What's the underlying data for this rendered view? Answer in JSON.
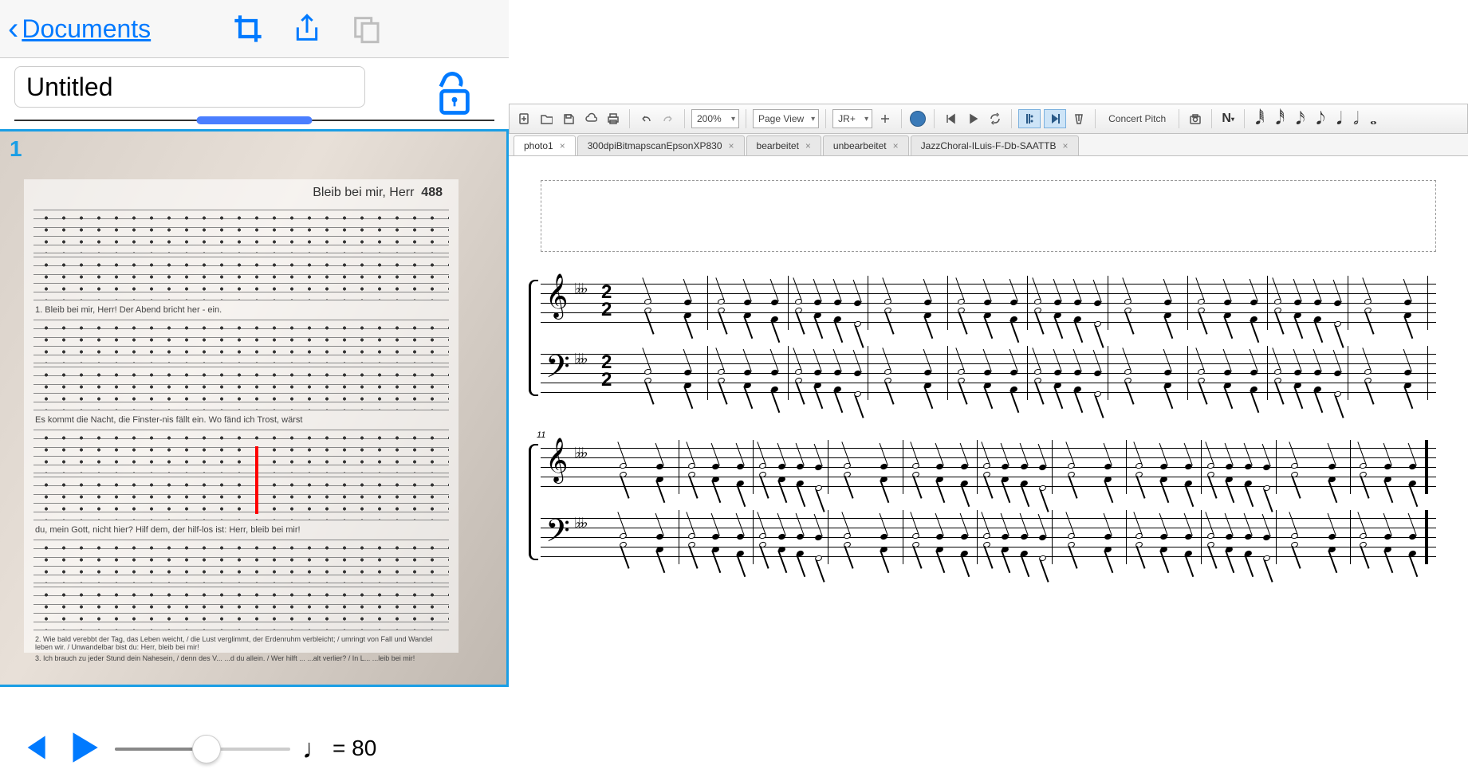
{
  "left_app": {
    "back_label": "Documents",
    "title_value": "Untitled",
    "page_number": "1",
    "sheet": {
      "title": "Bleib bei mir, Herr",
      "number": "488",
      "lyrics": [
        "1. Bleib bei mir, Herr! Der   Abend bricht her - ein.",
        "Es  kommt die Nacht, die  Finster-nis fällt  ein.    Wo    fänd ich Trost, wärst",
        "du, mein Gott, nicht hier?    Hilf dem, der hilf-los ist: Herr, bleib bei     mir!",
        "2. Wie bald verebbt der Tag, das Leben weicht, / die Lust verglimmt, der Erdenruhm verbleicht; / umringt von Fall und Wandel leben wir. / Unwandelbar bist du: Herr, bleib bei mir!",
        "3. Ich brauch zu jeder Stund dein Nahesein, / denn des V...   ...d du allein. / Wer hilft ...   ...alt verlier? / In L...   ...leib bei mir!"
      ]
    },
    "tempo": {
      "equals": "=",
      "bpm": "80"
    }
  },
  "musescore": {
    "zoom": "200%",
    "view_mode": "Page View",
    "style": "JR+",
    "concert_pitch": "Concert Pitch",
    "tabs": [
      {
        "label": "photo1",
        "active": true
      },
      {
        "label": "300dpiBitmapscanEpsonXP830",
        "active": false
      },
      {
        "label": "bearbeitet",
        "active": false
      },
      {
        "label": "unbearbeitet",
        "active": false
      },
      {
        "label": "JazzChoral-ILuis-F-Db-SAATTB",
        "active": false
      }
    ],
    "notation": {
      "time_signature": "2/2",
      "key_signature_flats": 3,
      "system2_start_measure": "11"
    },
    "note_durations": [
      "𝅘𝅥𝅱",
      "𝅘𝅥𝅰",
      "𝅘𝅥𝅯",
      "𝅘𝅥𝅮",
      "𝅘𝅥",
      "𝅗𝅥",
      "𝅝"
    ]
  }
}
